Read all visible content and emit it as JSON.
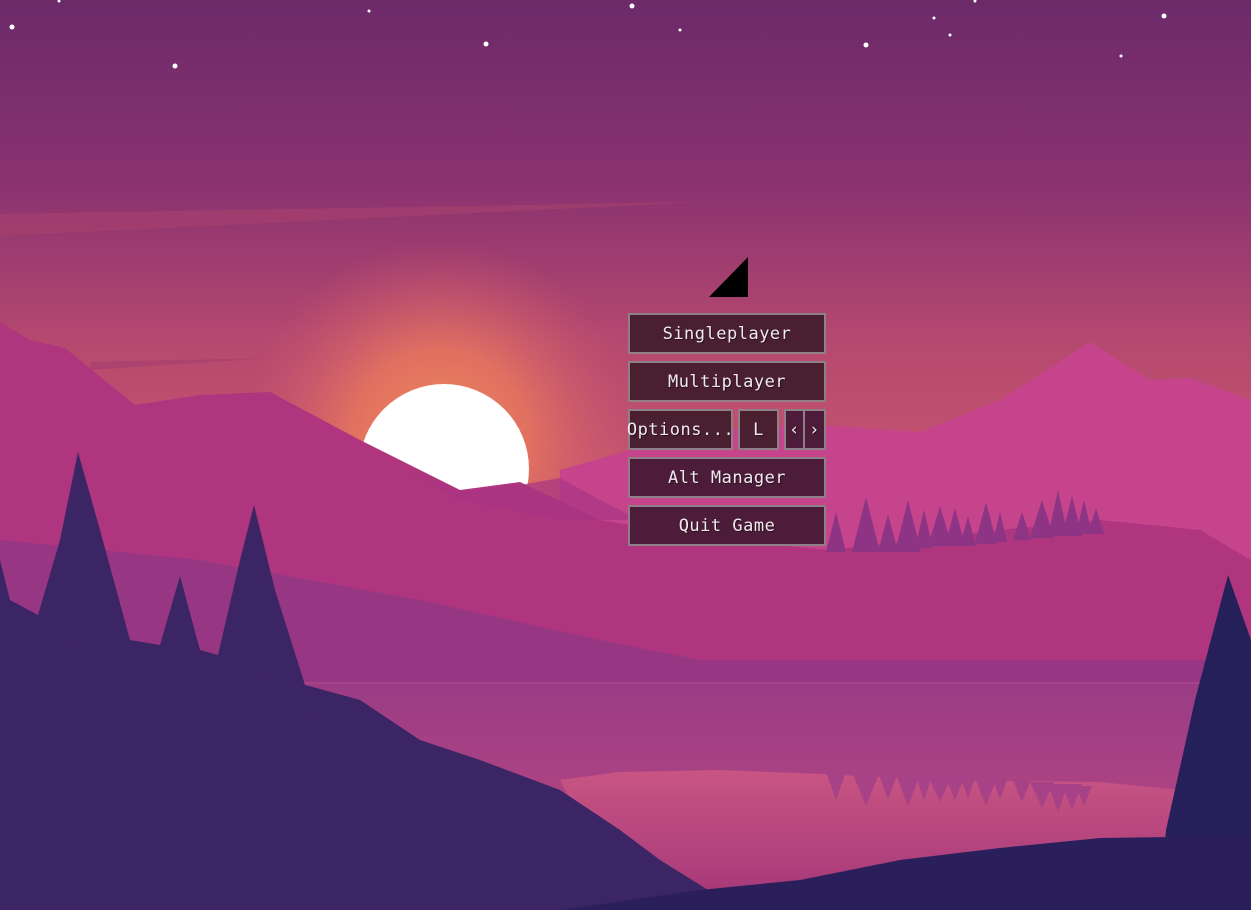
{
  "menu": {
    "singleplayer": "Singleplayer",
    "multiplayer": "Multiplayer",
    "options": "Options...",
    "language": "L",
    "arrow_left": "‹",
    "arrow_right": "›",
    "alt_manager": "Alt Manager",
    "quit": "Quit Game"
  },
  "colors": {
    "button_bg": "#4a2030",
    "button_border": "#8f7f86",
    "button_text": "#f1eaee",
    "sky_top": "#6f2c68",
    "sky_bottom": "#d2607a",
    "sun": "#ffffff"
  },
  "icons": {
    "logo": "triangle-logo-icon",
    "left": "chevron-left-icon",
    "right": "chevron-right-icon"
  }
}
